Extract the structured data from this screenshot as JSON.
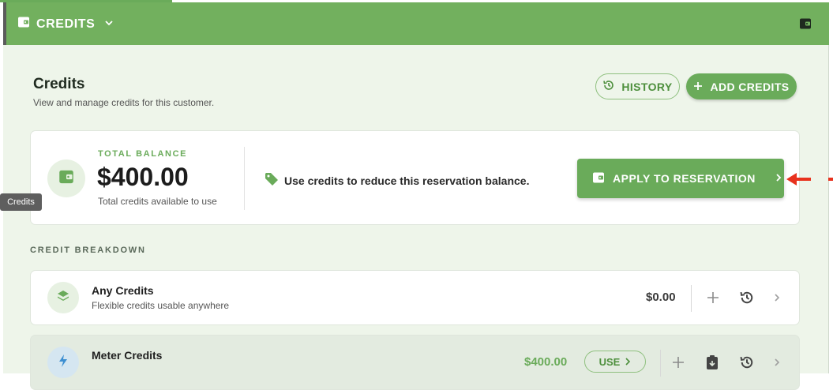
{
  "topbar": {
    "title": "CREDITS"
  },
  "header": {
    "title": "Credits",
    "subtitle": "View and manage credits for this customer.",
    "history_label": "HISTORY",
    "add_label": "ADD CREDITS"
  },
  "balance": {
    "label": "TOTAL BALANCE",
    "amount": "$400.00",
    "caption": "Total credits available to use",
    "info": "Use credits to reduce this reservation balance.",
    "apply_label": "APPLY TO RESERVATION"
  },
  "tooltip": {
    "text": "Credits"
  },
  "breakdown": {
    "label": "CREDIT BREAKDOWN",
    "rows": [
      {
        "name": "Any Credits",
        "desc": "Flexible credits usable anywhere",
        "amount": "$0.00"
      },
      {
        "name": "Meter Credits",
        "desc": "",
        "amount": "$400.00",
        "use_label": "USE"
      }
    ]
  },
  "colors": {
    "accent": "#6aab5a",
    "topbar": "#72b05e",
    "arrow": "#e8321e"
  }
}
